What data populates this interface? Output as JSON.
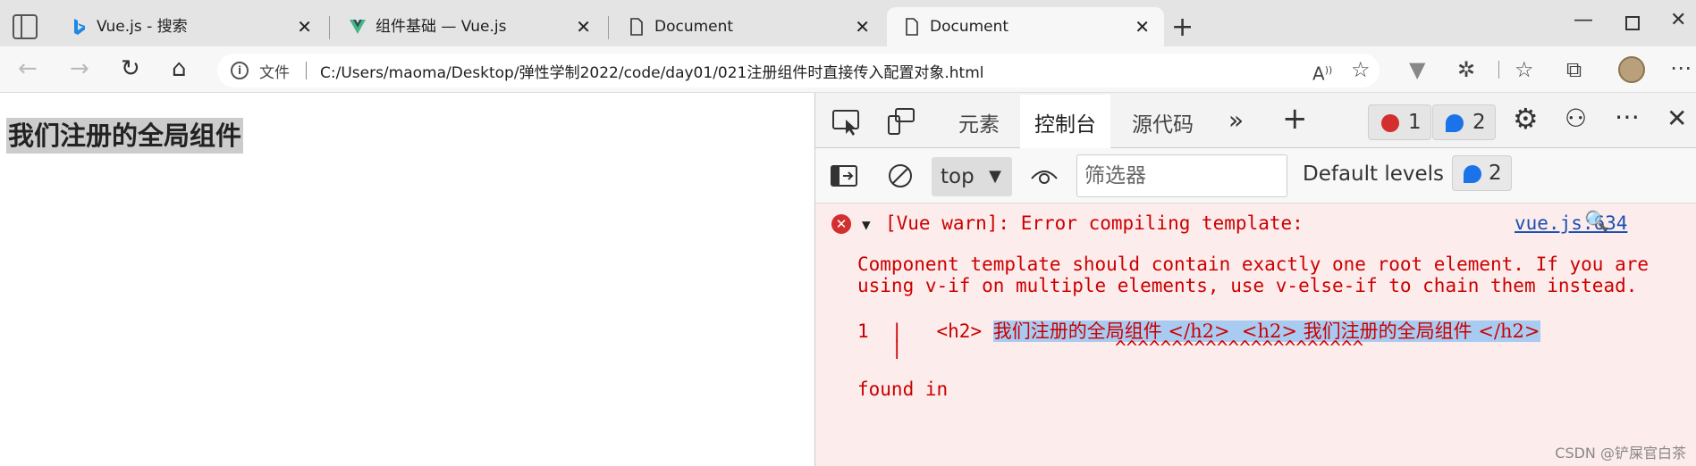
{
  "browser": {
    "tabs": [
      {
        "title": "Vue.js - 搜索",
        "icon": "bing-icon"
      },
      {
        "title": "组件基础 — Vue.js",
        "icon": "vue-icon"
      },
      {
        "title": "Document",
        "icon": "document-icon"
      },
      {
        "title": "Document",
        "icon": "document-icon",
        "active": true
      }
    ],
    "address": {
      "scheme_label": "文件",
      "url": "C:/Users/maoma/Desktop/弹性学制2022/code/day01/021注册组件时直接传入配置对象.html"
    }
  },
  "page": {
    "heading": "我们注册的全局组件"
  },
  "devtools": {
    "tabs": [
      "元素",
      "控制台",
      "源代码"
    ],
    "active_tab": "控制台",
    "error_count": "1",
    "message_count": "2",
    "context": "top",
    "filter_placeholder": "筛选器",
    "levels": "Default levels",
    "levels_count": "2",
    "console": {
      "head": "[Vue warn]: Error compiling template:",
      "source": "vue.js:634",
      "body1": "Component template should contain exactly one root element. If you are",
      "body2": "using v-if on multiple elements, use v-else-if to chain them instead.",
      "code_lineno": "1  |   ",
      "code_tag_open": "<h2>",
      "code_highlight_text": "我们注册的全局组件 </h2>  <h2> 我们注册的全局组件 </h2>",
      "pipe": "   |",
      "carets": "^^^^^^^^^^^^^^^^^^^^^^",
      "found_in": "found in"
    }
  },
  "watermark": "CSDN @铲屎官白茶",
  "colors": {
    "accent": "#1a73e8",
    "error": "#c00000",
    "console_bg": "#fdecec"
  }
}
